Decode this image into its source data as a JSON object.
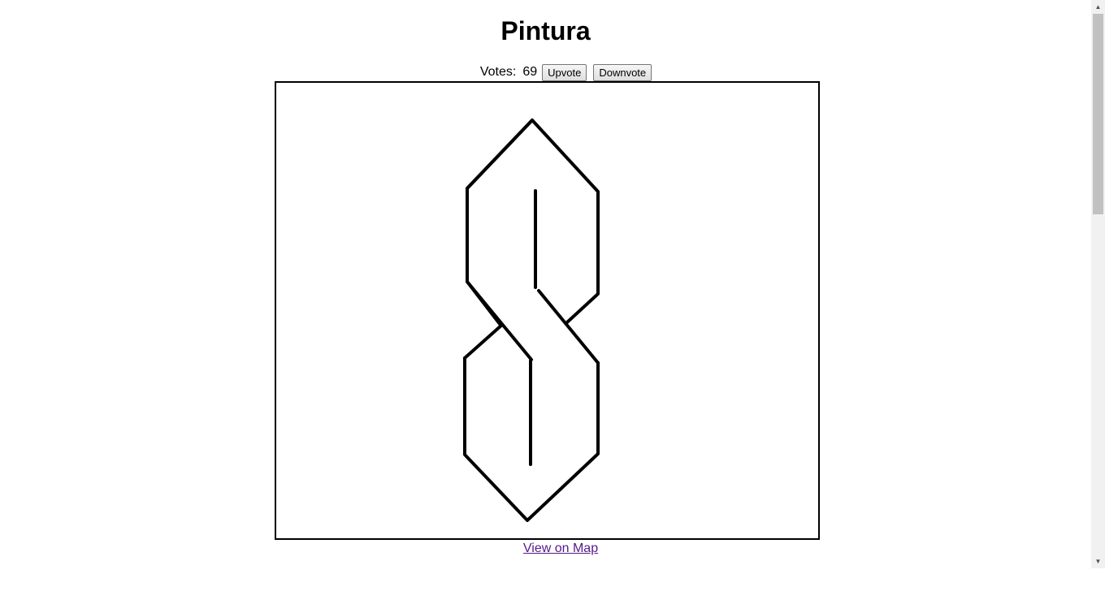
{
  "page": {
    "title": "Pintura"
  },
  "votes": {
    "label": "Votes:",
    "count": "69",
    "upvote_label": "Upvote",
    "downvote_label": "Downvote"
  },
  "map_link": {
    "label": "View on Map"
  },
  "colors": {
    "link": "#551a8b",
    "stroke": "#000000",
    "scrollbar_track": "#f1f1f1",
    "scrollbar_thumb": "#c1c1c1"
  },
  "scrollbar": {
    "up_icon": "triangle-up-icon",
    "down_icon": "triangle-down-icon"
  }
}
